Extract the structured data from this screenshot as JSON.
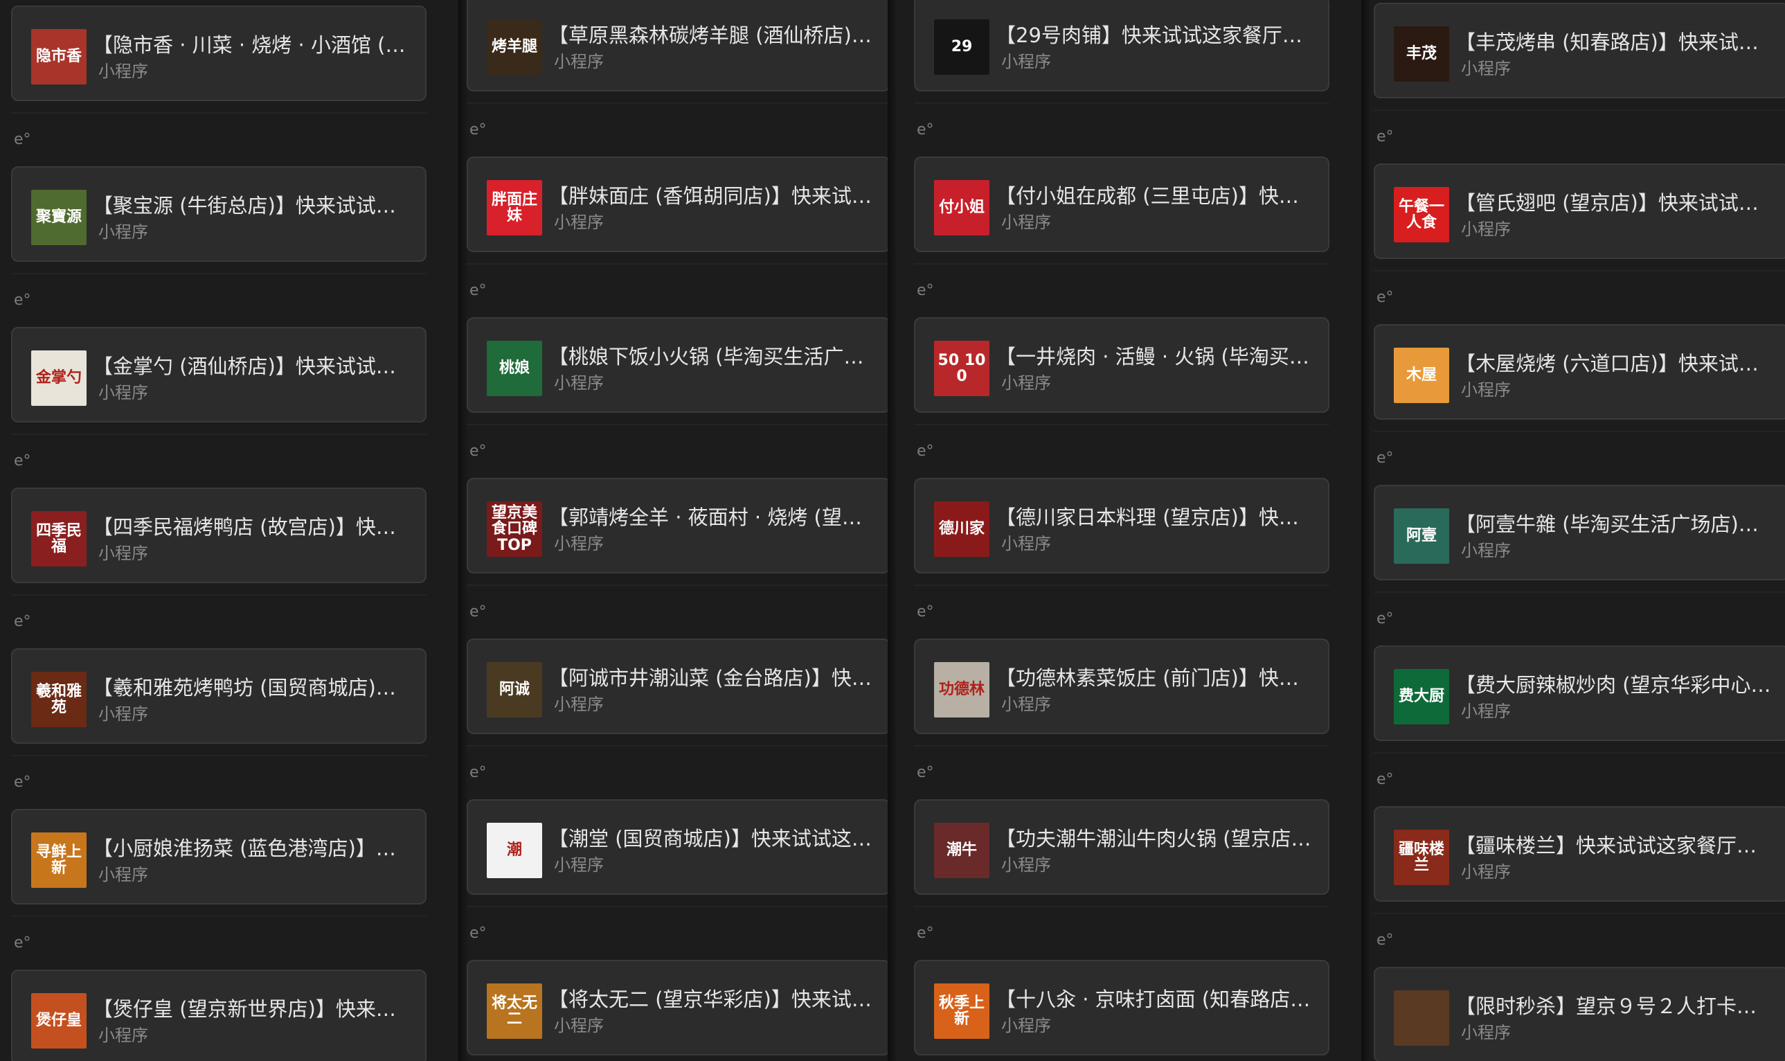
{
  "colors": {
    "background": "#1c1c1c",
    "card": "#2c2c2c",
    "card_border": "#3a3a3a",
    "title_text": "#e6e6e6",
    "subtitle_text": "#8a8a8a"
  },
  "columns": [
    {
      "cards": [
        {
          "title": "【隐市香 · 川菜 · 烧烤 · 小酒馆 (望…",
          "subtitle": "小程序",
          "thumb_text": "隐市香",
          "thumb_color": "#a8352a",
          "icon": "restaurant-thumbnail"
        },
        {
          "title": "【聚宝源 (牛街总店)】快来试试这…",
          "subtitle": "小程序",
          "thumb_text": "聚寶源",
          "thumb_color": "#4f6b2f",
          "icon": "restaurant-thumbnail"
        },
        {
          "title": "【金掌勺 (酒仙桥店)】快来试试这…",
          "subtitle": "小程序",
          "thumb_text": "金掌勺",
          "thumb_color": "#e8e4da",
          "icon": "restaurant-thumbnail"
        },
        {
          "title": "【四季民福烤鸭店 (故宫店)】快来…",
          "subtitle": "小程序",
          "thumb_text": "四季民福",
          "thumb_color": "#8a1f1f",
          "icon": "restaurant-thumbnail"
        },
        {
          "title": "【羲和雅苑烤鸭坊 (国贸商城店)】…",
          "subtitle": "小程序",
          "thumb_text": "羲和雅苑",
          "thumb_color": "#6b2a14",
          "icon": "restaurant-thumbnail"
        },
        {
          "title": "【小厨娘淮扬菜 (蓝色港湾店)】快…",
          "subtitle": "小程序",
          "thumb_text": "寻鲜上新",
          "thumb_color": "#c8761c",
          "icon": "restaurant-thumbnail"
        },
        {
          "title": "【煲仔皇 (望京新世界店)】快来试…",
          "subtitle": "小程序",
          "thumb_text": "煲仔皇",
          "thumb_color": "#c5501f",
          "icon": "restaurant-thumbnail"
        }
      ]
    },
    {
      "cards": [
        {
          "title": "【草原黑森林碳烤羊腿 (酒仙桥店)…",
          "subtitle": "小程序",
          "thumb_text": "烤羊腿",
          "thumb_color": "#3a2a1a",
          "icon": "restaurant-thumbnail"
        },
        {
          "title": "【胖妹面庄 (香饵胡同店)】快来试…",
          "subtitle": "小程序",
          "thumb_text": "胖面庄妹",
          "thumb_color": "#d8212a",
          "icon": "restaurant-thumbnail"
        },
        {
          "title": "【桃娘下饭小火锅 (毕淘买生活广…",
          "subtitle": "小程序",
          "thumb_text": "桃娘",
          "thumb_color": "#1f6b3a",
          "icon": "restaurant-thumbnail"
        },
        {
          "title": "【郭靖烤全羊 · 莜面村 · 烧烤 (望京…",
          "subtitle": "小程序",
          "thumb_text": "望京美食口碑TOP",
          "thumb_color": "#7a1a1a",
          "icon": "restaurant-thumbnail"
        },
        {
          "title": "【阿诚市井潮汕菜 (金台路店)】快…",
          "subtitle": "小程序",
          "thumb_text": "阿诚",
          "thumb_color": "#4a3a22",
          "icon": "restaurant-thumbnail"
        },
        {
          "title": "【潮堂 (国贸商城店)】快来试试这…",
          "subtitle": "小程序",
          "thumb_text": "潮",
          "thumb_color": "#f2f2f2",
          "icon": "restaurant-thumbnail"
        },
        {
          "title": "【将太无二 (望京华彩店)】快来试…",
          "subtitle": "小程序",
          "thumb_text": "将太无二",
          "thumb_color": "#b8741e",
          "icon": "restaurant-thumbnail"
        }
      ]
    },
    {
      "cards": [
        {
          "title": "【29号肉铺】快来试试这家餐厅吧！",
          "subtitle": "小程序",
          "thumb_text": "29",
          "thumb_color": "#151515",
          "icon": "restaurant-thumbnail"
        },
        {
          "title": "【付小姐在成都 (三里屯店)】快来…",
          "subtitle": "小程序",
          "thumb_text": "付小姐",
          "thumb_color": "#c8202a",
          "icon": "restaurant-thumbnail"
        },
        {
          "title": "【一井烧肉 · 活鳗 · 火锅 (毕淘买生…",
          "subtitle": "小程序",
          "thumb_text": "50 100",
          "thumb_color": "#b8282a",
          "icon": "restaurant-thumbnail"
        },
        {
          "title": "【德川家日本料理 (望京店)】快来…",
          "subtitle": "小程序",
          "thumb_text": "德川家",
          "thumb_color": "#8a1a1a",
          "icon": "restaurant-thumbnail"
        },
        {
          "title": "【功德林素菜饭庄 (前门店)】快来…",
          "subtitle": "小程序",
          "thumb_text": "功德林",
          "thumb_color": "#b8b0a4",
          "icon": "restaurant-thumbnail"
        },
        {
          "title": "【功夫潮牛潮汕牛肉火锅 (望京店)…",
          "subtitle": "小程序",
          "thumb_text": "潮牛",
          "thumb_color": "#6a2a2a",
          "icon": "restaurant-thumbnail"
        },
        {
          "title": "【十八汆 · 京味打卤面 (知春路店)…",
          "subtitle": "小程序",
          "thumb_text": "秋季上新",
          "thumb_color": "#d8621a",
          "icon": "restaurant-thumbnail"
        }
      ]
    },
    {
      "cards": [
        {
          "title": "【丰茂烤串 (知春路店)】快来试试…",
          "subtitle": "小程序",
          "thumb_text": "丰茂",
          "thumb_color": "#2a1a12",
          "icon": "restaurant-thumbnail"
        },
        {
          "title": "【管氏翅吧 (望京店)】快来试试这…",
          "subtitle": "小程序",
          "thumb_text": "午餐一人食",
          "thumb_color": "#d81e1e",
          "icon": "restaurant-thumbnail"
        },
        {
          "title": "【木屋烧烤 (六道口店)】快来试试…",
          "subtitle": "小程序",
          "thumb_text": "木屋",
          "thumb_color": "#e89a3a",
          "icon": "restaurant-thumbnail"
        },
        {
          "title": "【阿壹牛雜 (毕淘买生活广场店)】…",
          "subtitle": "小程序",
          "thumb_text": "阿壹",
          "thumb_color": "#2a6a5a",
          "icon": "restaurant-thumbnail"
        },
        {
          "title": "【费大厨辣椒炒肉 (望京华彩中心…",
          "subtitle": "小程序",
          "thumb_text": "费大厨",
          "thumb_color": "#0f6a3a",
          "icon": "restaurant-thumbnail"
        },
        {
          "title": "【疆味楼兰】快来试试这家餐厅吧！",
          "subtitle": "小程序",
          "thumb_text": "疆味楼兰",
          "thumb_color": "#8a2a1a",
          "icon": "restaurant-thumbnail"
        },
        {
          "title": "【限时秒杀】望京９号２人打卡尝鲜…",
          "subtitle": "小程序",
          "thumb_text": "",
          "thumb_color": "#5a3a22",
          "icon": "restaurant-thumbnail"
        }
      ]
    }
  ],
  "mark_text": "e°"
}
